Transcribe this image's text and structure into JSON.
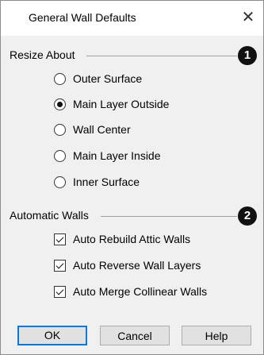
{
  "dialog": {
    "title": "General Wall Defaults",
    "close_symbol": "✕"
  },
  "resize_about": {
    "label": "Resize About",
    "callout": "1",
    "options": [
      {
        "label": "Outer Surface",
        "selected": false
      },
      {
        "label": "Main Layer Outside",
        "selected": true
      },
      {
        "label": "Wall Center",
        "selected": false
      },
      {
        "label": "Main Layer Inside",
        "selected": false
      },
      {
        "label": "Inner Surface",
        "selected": false
      }
    ]
  },
  "automatic_walls": {
    "label": "Automatic Walls",
    "callout": "2",
    "options": [
      {
        "label": "Auto Rebuild Attic Walls",
        "checked": true
      },
      {
        "label": "Auto Reverse Wall Layers",
        "checked": true
      },
      {
        "label": "Auto Merge Collinear Walls",
        "checked": true
      }
    ]
  },
  "buttons": {
    "ok": "OK",
    "cancel": "Cancel",
    "help": "Help"
  },
  "colors": {
    "accent": "#0078d7",
    "background": "#f0f0f0"
  }
}
